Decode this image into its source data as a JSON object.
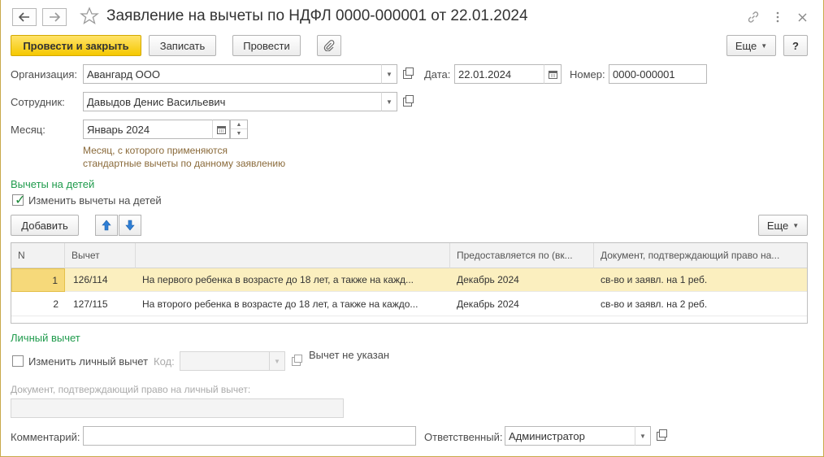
{
  "window": {
    "title": "Заявление на вычеты по НДФЛ 0000-000001 от 22.01.2024",
    "back_icon": "arrow-left-icon",
    "forward_icon": "arrow-right-icon",
    "favorite_icon": "star-icon",
    "link_icon": "link-icon",
    "more_icon": "kebab-icon",
    "close_icon": "close-icon"
  },
  "toolbar": {
    "post_close_label": "Провести и закрыть",
    "save_label": "Записать",
    "post_label": "Провести",
    "attach_icon": "paperclip-icon",
    "more_label": "Еще",
    "help_label": "?"
  },
  "form": {
    "org_label": "Организация:",
    "org_value": "Авангард ООО",
    "date_label": "Дата:",
    "date_value": "22.01.2024",
    "number_label": "Номер:",
    "number_value": "0000-000001",
    "employee_label": "Сотрудник:",
    "employee_value": "Давыдов Денис Васильевич",
    "month_label": "Месяц:",
    "month_value": "Январь 2024",
    "month_hint_1": "Месяц, с которого применяются",
    "month_hint_2": "стандартные вычеты по данному заявлению"
  },
  "children": {
    "section_title": "Вычеты на детей",
    "change_label": "Изменить вычеты на детей",
    "change_checked": true,
    "add_label": "Добавить",
    "more_label": "Еще",
    "columns": [
      "N",
      "Вычет",
      "",
      "Предоставляется по (вк...",
      "Документ, подтверждающий право на..."
    ],
    "rows": [
      {
        "n": "1",
        "code": "126/114",
        "desc": "На первого ребенка в возрасте до 18 лет, а также на кажд...",
        "until": "Декабрь 2024",
        "doc": "св-во и заявл. на 1 реб."
      },
      {
        "n": "2",
        "code": "127/115",
        "desc": "На второго ребенка в возрасте до 18 лет, а также на каждо...",
        "until": "Декабрь 2024",
        "doc": "св-во и заявл. на 2 реб."
      }
    ]
  },
  "personal": {
    "section_title": "Личный вычет",
    "change_label": "Изменить личный вычет",
    "change_checked": false,
    "code_label": "Код:",
    "code_value": "",
    "not_specified": "Вычет не указан",
    "doc_label": "Документ, подтверждающий право на личный вычет:",
    "doc_value": ""
  },
  "footer": {
    "comment_label": "Комментарий:",
    "comment_value": "",
    "responsible_label": "Ответственный:",
    "responsible_value": "Администратор"
  },
  "colors": {
    "primary_button": "#f5c800",
    "section_title": "#1f9b4c",
    "selected_row": "#fbefbf",
    "hint_text": "#8a6a3a"
  }
}
